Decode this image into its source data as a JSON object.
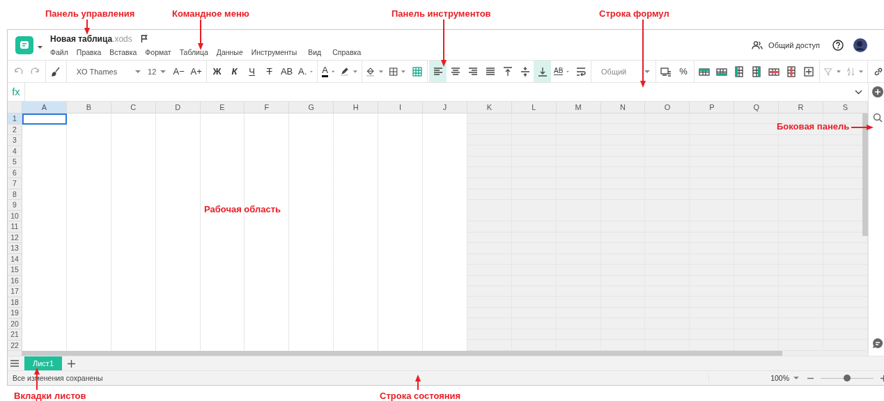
{
  "header": {
    "doc_name": "Новая таблица",
    "doc_ext": ".xods",
    "menu": [
      "Файл",
      "Правка",
      "Вставка",
      "Формат",
      "Таблица",
      "Данные",
      "Инструменты",
      "Вид",
      "Справка"
    ],
    "share": "Общий доступ"
  },
  "toolbar": [
    {
      "kind": "undo",
      "selected": false
    },
    {
      "kind": "redo",
      "selected": false
    },
    {
      "kind": "sep"
    },
    {
      "kind": "brush",
      "selected": false
    },
    {
      "kind": "sep"
    },
    {
      "kind": "font",
      "label": "XO Thames"
    },
    {
      "kind": "size",
      "label": "12"
    },
    {
      "kind": "text",
      "label": "A−",
      "selected": false
    },
    {
      "kind": "text",
      "label": "A+",
      "selected": false
    },
    {
      "kind": "sep"
    },
    {
      "kind": "bold",
      "label": "Ж",
      "selected": false
    },
    {
      "kind": "italic",
      "label": "К",
      "selected": false
    },
    {
      "kind": "underline",
      "label": "Ч",
      "selected": false
    },
    {
      "kind": "strike",
      "label": "Т",
      "selected": false
    },
    {
      "kind": "text",
      "label": "АВ",
      "selected": false
    },
    {
      "kind": "text",
      "label": "А.",
      "selected": false,
      "menu": true
    },
    {
      "kind": "sep"
    },
    {
      "kind": "fontcolor",
      "label": "А",
      "selected": false,
      "menu": true
    },
    {
      "kind": "marker",
      "selected": false,
      "menu": true
    },
    {
      "kind": "sep"
    },
    {
      "kind": "bucket",
      "selected": false,
      "menu": true
    },
    {
      "kind": "borders",
      "selected": false,
      "menu": true
    },
    {
      "kind": "grid",
      "selected": false
    },
    {
      "kind": "sep"
    },
    {
      "kind": "alignleft",
      "selected": true
    },
    {
      "kind": "aligncenter",
      "selected": false
    },
    {
      "kind": "alignright",
      "selected": false
    },
    {
      "kind": "justify",
      "selected": false
    },
    {
      "kind": "top",
      "selected": false
    },
    {
      "kind": "middle",
      "selected": false
    },
    {
      "kind": "bottom",
      "selected": true
    },
    {
      "kind": "textdir",
      "label": "AB",
      "selected": false,
      "menu": true
    },
    {
      "kind": "wrap",
      "selected": false
    },
    {
      "kind": "sep"
    },
    {
      "kind": "format",
      "label": "Общий"
    },
    {
      "kind": "sep"
    },
    {
      "kind": "numformat",
      "selected": false
    },
    {
      "kind": "text",
      "label": "%",
      "selected": false
    },
    {
      "kind": "sep"
    },
    {
      "kind": "rowabove",
      "selected": false
    },
    {
      "kind": "rowbelow",
      "selected": false
    },
    {
      "kind": "colleft",
      "selected": false
    },
    {
      "kind": "colright",
      "selected": false
    },
    {
      "kind": "delrow",
      "selected": false
    },
    {
      "kind": "delcol",
      "selected": false
    },
    {
      "kind": "merge",
      "selected": false
    },
    {
      "kind": "sep"
    },
    {
      "kind": "filter",
      "selected": false,
      "menu": true
    },
    {
      "kind": "sort",
      "selected": false,
      "menu": true
    },
    {
      "kind": "sep"
    },
    {
      "kind": "link",
      "selected": false
    }
  ],
  "columns": [
    {
      "label": "A",
      "selected": true,
      "shaded": false
    },
    {
      "label": "B",
      "selected": false,
      "shaded": false
    },
    {
      "label": "C",
      "selected": false,
      "shaded": false
    },
    {
      "label": "D",
      "selected": false,
      "shaded": false
    },
    {
      "label": "E",
      "selected": false,
      "shaded": false
    },
    {
      "label": "F",
      "selected": false,
      "shaded": false
    },
    {
      "label": "G",
      "selected": false,
      "shaded": false
    },
    {
      "label": "H",
      "selected": false,
      "shaded": false
    },
    {
      "label": "I",
      "selected": false,
      "shaded": false
    },
    {
      "label": "J",
      "selected": false,
      "shaded": false
    },
    {
      "label": "K",
      "selected": false,
      "shaded": true
    },
    {
      "label": "L",
      "selected": false,
      "shaded": true
    },
    {
      "label": "M",
      "selected": false,
      "shaded": true
    },
    {
      "label": "N",
      "selected": false,
      "shaded": true
    },
    {
      "label": "O",
      "selected": false,
      "shaded": true
    },
    {
      "label": "P",
      "selected": false,
      "shaded": true
    },
    {
      "label": "Q",
      "selected": false,
      "shaded": true
    },
    {
      "label": "R",
      "selected": false,
      "shaded": true
    },
    {
      "label": "S",
      "selected": false,
      "shaded": true
    }
  ],
  "rows": [
    {
      "label": "1",
      "selected": true
    },
    {
      "label": "2",
      "selected": false
    },
    {
      "label": "3",
      "selected": false
    },
    {
      "label": "4",
      "selected": false
    },
    {
      "label": "5",
      "selected": false
    },
    {
      "label": "6",
      "selected": false
    },
    {
      "label": "7",
      "selected": false
    },
    {
      "label": "8",
      "selected": false
    },
    {
      "label": "9",
      "selected": false
    },
    {
      "label": "10",
      "selected": false
    },
    {
      "label": "11",
      "selected": false
    },
    {
      "label": "12",
      "selected": false
    },
    {
      "label": "13",
      "selected": false
    },
    {
      "label": "14",
      "selected": false
    },
    {
      "label": "15",
      "selected": false
    },
    {
      "label": "16",
      "selected": false
    },
    {
      "label": "17",
      "selected": false
    },
    {
      "label": "18",
      "selected": false
    },
    {
      "label": "19",
      "selected": false
    },
    {
      "label": "20",
      "selected": false
    },
    {
      "label": "21",
      "selected": false
    },
    {
      "label": "22",
      "selected": false
    }
  ],
  "sheet_tabs": [
    {
      "label": "Лист1",
      "selected": true
    }
  ],
  "status_bar": {
    "message": "Все изменения сохранены",
    "zoom": "100%",
    "zoom_slider": {
      "level": 0.5
    }
  },
  "formula_bar": {
    "label": "fx"
  },
  "annotations": [
    {
      "text": "Панель управления"
    },
    {
      "text": "Командное меню"
    },
    {
      "text": "Панель инструментов"
    },
    {
      "text": "Строка формул"
    },
    {
      "text": "Боковая панель"
    },
    {
      "text": "Рабочая область"
    },
    {
      "text": "Вкладки листов"
    },
    {
      "text": "Строка состояния"
    }
  ]
}
